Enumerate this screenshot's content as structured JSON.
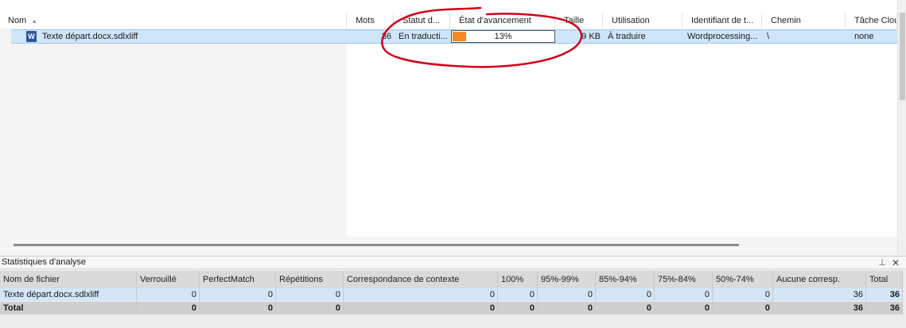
{
  "file_list": {
    "columns": {
      "nom": "Nom",
      "mots": "Mots",
      "statut": "Statut d...",
      "etat": "État d'avancement",
      "taille": "Taille",
      "utilisation": "Utilisation",
      "identifiant": "Identifiant de t...",
      "chemin": "Chemin",
      "tache": "Tâche Clou"
    },
    "rows": [
      {
        "nom": "Texte départ.docx.sdlxliff",
        "mots": "36",
        "statut": "En traducti...",
        "progress_percent": 13,
        "progress_label": "13%",
        "taille": "9 KB",
        "utilisation": "À traduire",
        "identifiant": "Wordprocessing...",
        "chemin": "\\",
        "tache": "none"
      }
    ],
    "file_icon": "word-document-icon",
    "progress_color": "#f28a25",
    "selection_color": "#cfe5fa",
    "annotation_color": "#d0021b"
  },
  "stats": {
    "title": "Statistiques d'analyse",
    "pin_icon": "pin-icon",
    "close_icon": "close-icon",
    "columns": [
      "Nom de fichier",
      "Verrouillé",
      "PerfectMatch",
      "Répétitions",
      "Correspondance de contexte",
      "100%",
      "95%-99%",
      "85%-94%",
      "75%-84%",
      "50%-74%",
      "Aucune corresp.",
      "Total"
    ],
    "rows": [
      [
        "Texte départ.docx.sdlxliff",
        "0",
        "0",
        "0",
        "0",
        "0",
        "0",
        "0",
        "0",
        "0",
        "36",
        "36"
      ]
    ],
    "total_row": [
      "Total",
      "0",
      "0",
      "0",
      "0",
      "0",
      "0",
      "0",
      "0",
      "0",
      "36",
      "36"
    ]
  }
}
